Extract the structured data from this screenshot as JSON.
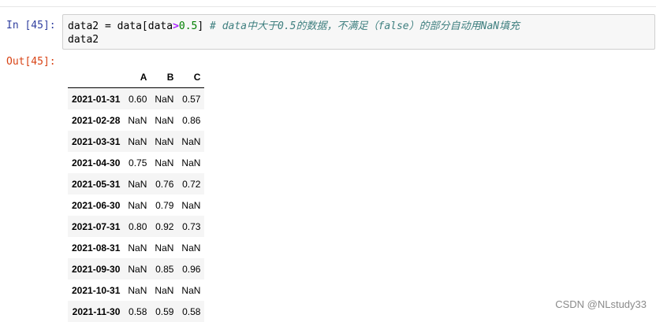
{
  "input_cell": {
    "prompt": "In [45]:",
    "line1": {
      "var": "data2",
      "assign": " = ",
      "expr_start": "data[data",
      "op": ">",
      "num": "0.5",
      "expr_end": "] ",
      "comment": "# data中大于0.5的数据，不满足（false）的部分自动用NaN填充"
    },
    "line2": "data2"
  },
  "output_cell": {
    "prompt": "Out[45]:",
    "columns": [
      "A",
      "B",
      "C"
    ],
    "rows": [
      {
        "index": "2021-01-31",
        "values": [
          "0.60",
          "NaN",
          "0.57"
        ]
      },
      {
        "index": "2021-02-28",
        "values": [
          "NaN",
          "NaN",
          "0.86"
        ]
      },
      {
        "index": "2021-03-31",
        "values": [
          "NaN",
          "NaN",
          "NaN"
        ]
      },
      {
        "index": "2021-04-30",
        "values": [
          "0.75",
          "NaN",
          "NaN"
        ]
      },
      {
        "index": "2021-05-31",
        "values": [
          "NaN",
          "0.76",
          "0.72"
        ]
      },
      {
        "index": "2021-06-30",
        "values": [
          "NaN",
          "0.79",
          "NaN"
        ]
      },
      {
        "index": "2021-07-31",
        "values": [
          "0.80",
          "0.92",
          "0.73"
        ]
      },
      {
        "index": "2021-08-31",
        "values": [
          "NaN",
          "NaN",
          "NaN"
        ]
      },
      {
        "index": "2021-09-30",
        "values": [
          "NaN",
          "0.85",
          "0.96"
        ]
      },
      {
        "index": "2021-10-31",
        "values": [
          "NaN",
          "NaN",
          "NaN"
        ]
      },
      {
        "index": "2021-11-30",
        "values": [
          "0.58",
          "0.59",
          "0.58"
        ]
      }
    ]
  },
  "watermark": "CSDN @NLstudy33",
  "colors": {
    "in_prompt": "#303f9f",
    "out_prompt": "#d84315",
    "operator": "#aa22ff",
    "number": "#008000",
    "comment": "#408080",
    "code_bg": "#f7f7f7"
  }
}
